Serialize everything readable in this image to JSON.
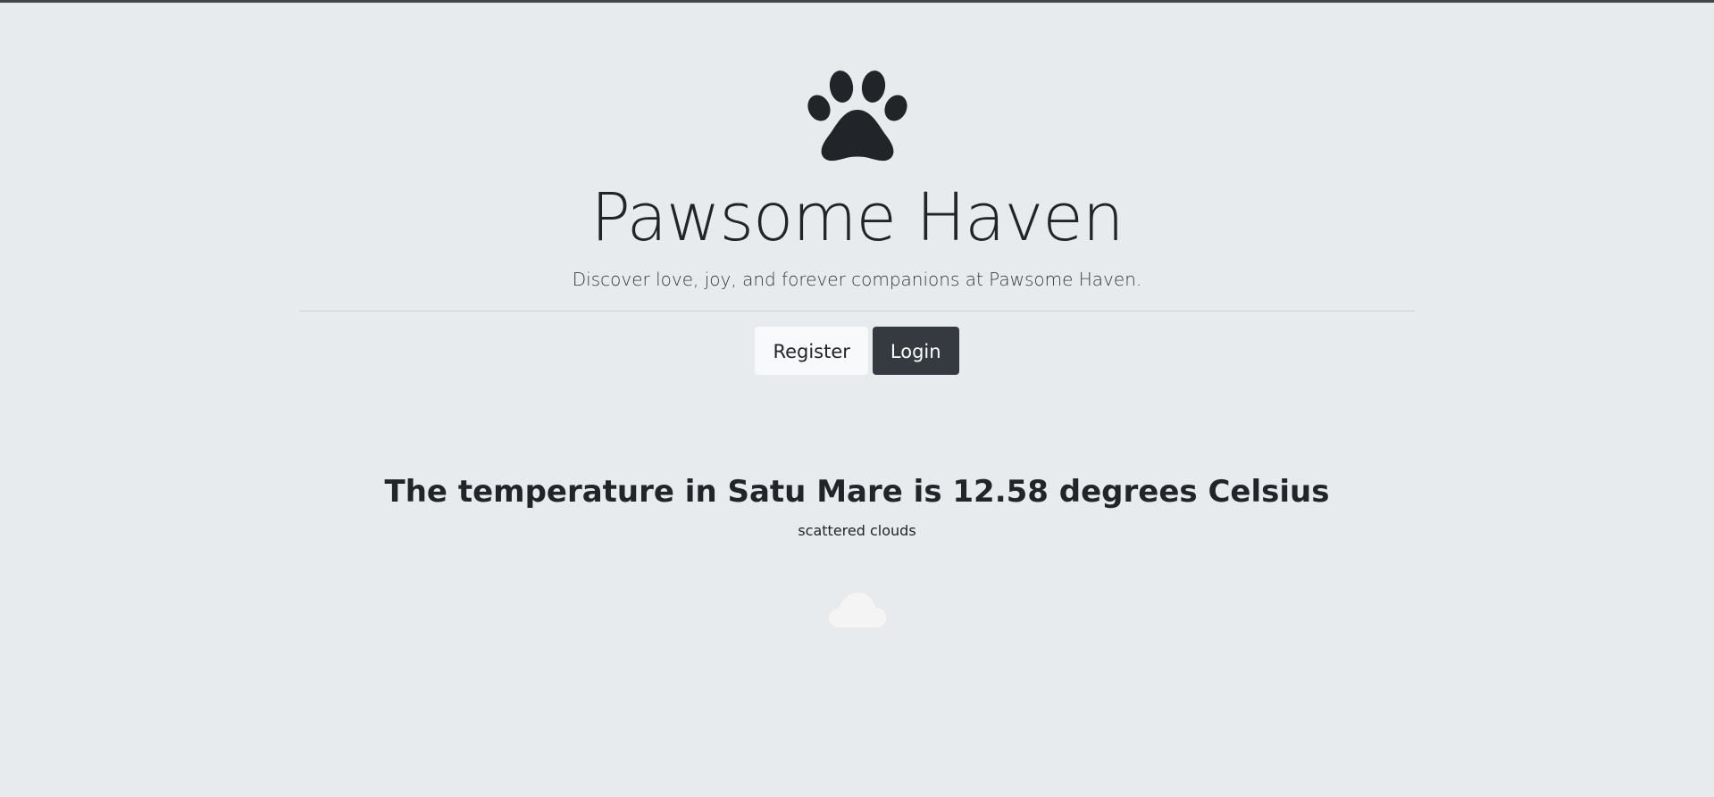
{
  "brand": {
    "icon": "paw-icon",
    "title": "Pawsome Haven",
    "tagline": "Discover love, joy, and forever companions at Pawsome Haven."
  },
  "actions": {
    "register_label": "Register",
    "login_label": "Login"
  },
  "weather": {
    "heading": "The temperature in Satu Mare is 12.58 degrees Celsius",
    "description": "scattered clouds",
    "icon": "cloud-icon"
  },
  "colors": {
    "background": "#e8ebee",
    "text": "#212529",
    "login_button": "#343a40",
    "register_button": "#f8f9fa",
    "cloud": "#f4f4f4"
  }
}
